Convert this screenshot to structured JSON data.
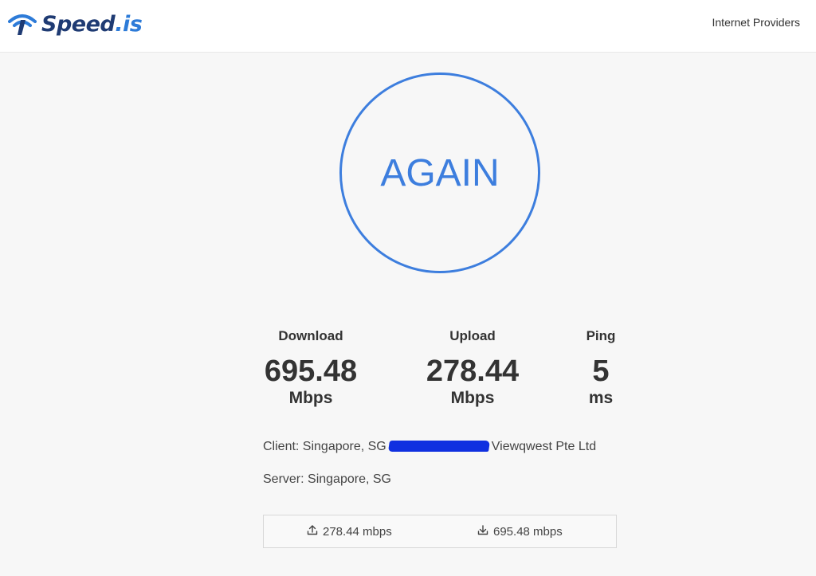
{
  "header": {
    "logo_part1": "Speed",
    "logo_part2": ".is",
    "nav_link": "Internet Providers"
  },
  "test_button": {
    "label": "AGAIN"
  },
  "results": {
    "download": {
      "label": "Download",
      "value": "695.48",
      "unit": "Mbps"
    },
    "upload": {
      "label": "Upload",
      "value": "278.44",
      "unit": "Mbps"
    },
    "ping": {
      "label": "Ping",
      "value": "5",
      "unit": "ms"
    }
  },
  "client": {
    "prefix": "Client: Singapore, SG",
    "isp": "Viewqwest Pte Ltd"
  },
  "server": {
    "text": "Server: Singapore, SG"
  },
  "history": {
    "upload": "278.44 mbps",
    "download": "695.48 mbps"
  },
  "colors": {
    "accent": "#3d7ede",
    "logo_dark": "#1f3b73",
    "logo_light": "#2d7bd8",
    "redaction": "#1030e0"
  },
  "icons": {
    "logo": "signal-logo-icon",
    "upload": "upload-icon",
    "download": "download-icon"
  }
}
